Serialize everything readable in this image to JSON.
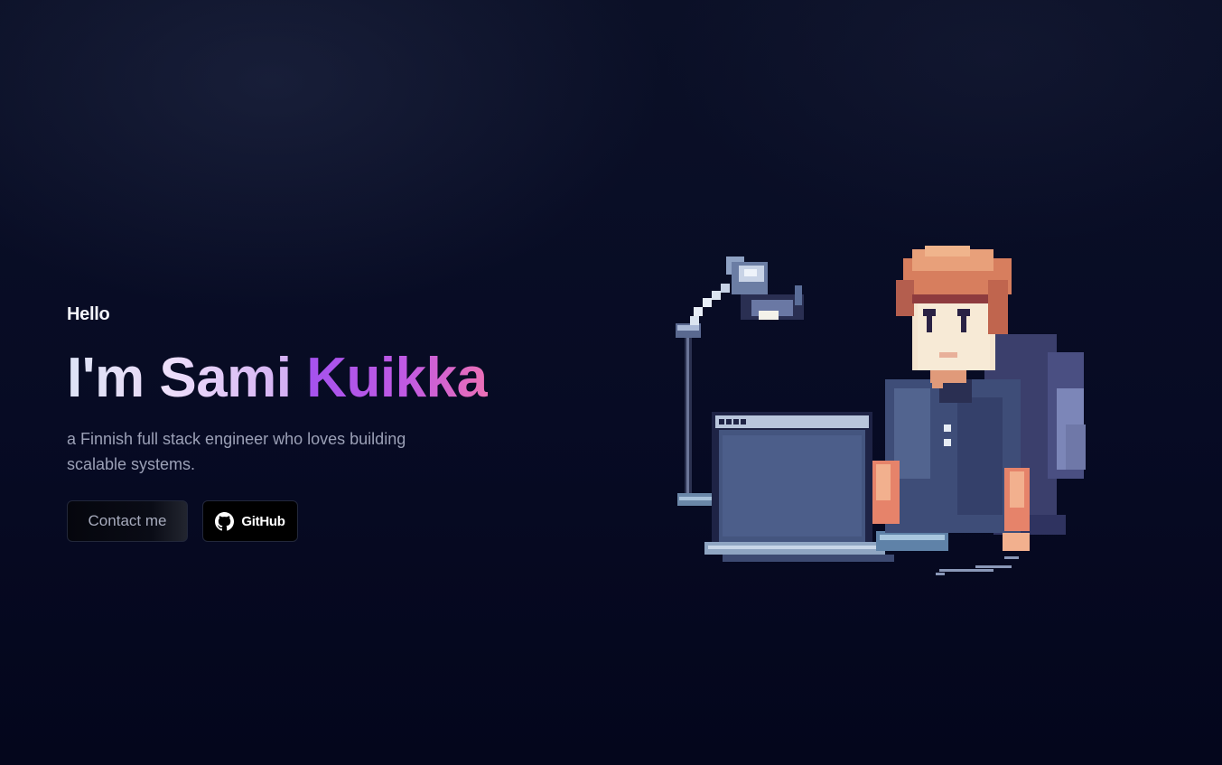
{
  "hero": {
    "greeting": "Hello",
    "title_lead": "I'm",
    "title_first": "Sami",
    "title_last": "Kuikka",
    "tagline": "a Finnish full stack engineer who loves building scalable systems."
  },
  "actions": {
    "contact_label": "Contact me",
    "github_label": "GitHub",
    "github_icon": "github-icon"
  },
  "illustration": {
    "subject": "pixel-art-developer-at-laptop"
  },
  "colors": {
    "background": "#070b24",
    "gradient_start": "#a452ee",
    "gradient_end": "#ec70b6",
    "tagline": "#9ba0b6"
  }
}
